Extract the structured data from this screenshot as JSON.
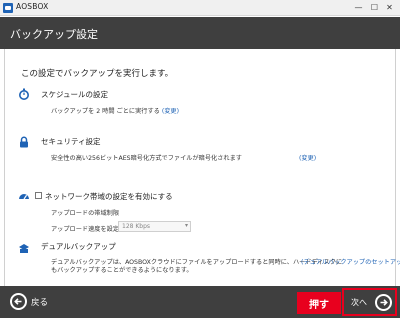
{
  "window": {
    "app_title": "AOSBOX",
    "minimize_label": "—",
    "maximize_label": "☐",
    "close_label": "✕"
  },
  "header": {
    "title": "バックアップ設定"
  },
  "intro": "この設定でバックアップを実行します。",
  "schedule": {
    "title": "スケジュールの設定",
    "text": "バックアップを 2 時間 ごとに実行する",
    "link": "(変更)"
  },
  "security": {
    "title": "セキュリティ設定",
    "text": "安全性の高い256ビットAES暗号化方式でファイルが暗号化されます",
    "link": "(変更)"
  },
  "bandwidth": {
    "title": "ネットワーク帯域の設定を有効にする",
    "checked": false,
    "subtitle": "アップロードの帯域制限",
    "speed_label": "アップロード速度を設定",
    "speed_value": "128 Kbps"
  },
  "dual": {
    "title": "デュアルバックアップ",
    "line1": "デュアルバックアップは、AOSBOXクラウドにファイルをアップロードすると同時に、ハードディスクに",
    "line2": "もバックアップすることができるようになります。",
    "link": "(デュアルバックアップのセットアップ)"
  },
  "footer": {
    "back_label": "戻る",
    "push_label": "押す",
    "next_label": "次へ"
  },
  "colors": {
    "accent": "#1f63b5",
    "header_bg": "#3f3f3f",
    "highlight": "#e8001e"
  },
  "icons": {
    "app": "aosbox-logo-icon",
    "schedule": "stopwatch-icon",
    "security": "lock-icon",
    "bandwidth": "speedometer-icon",
    "dual": "backup-stack-icon",
    "back": "arrow-left-circle-icon",
    "next": "arrow-right-circle-icon"
  }
}
